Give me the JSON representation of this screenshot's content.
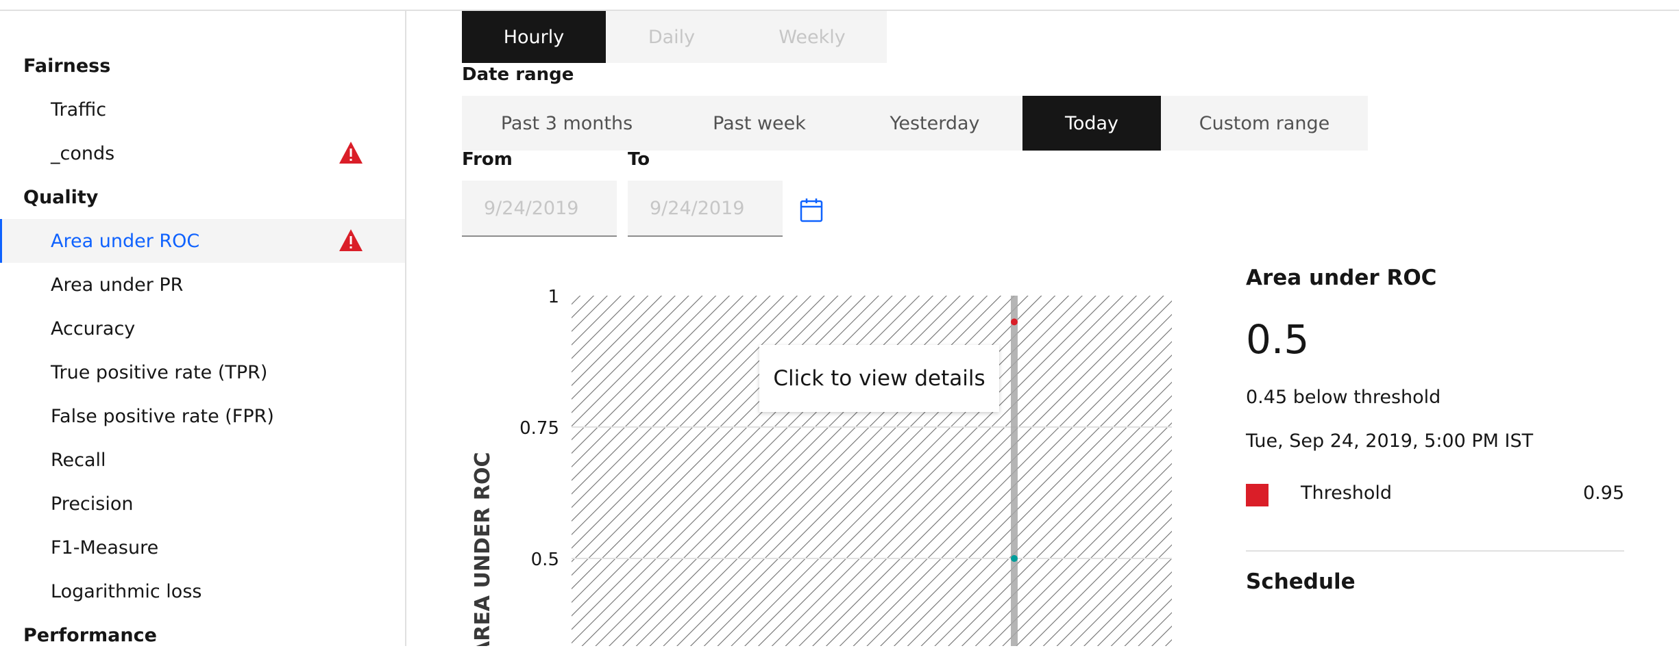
{
  "sidebar": {
    "items": [
      {
        "label": "Fairness",
        "type": "group"
      },
      {
        "label": "Traffic",
        "type": "item"
      },
      {
        "label": "_conds",
        "type": "item",
        "warning": true
      },
      {
        "label": "Quality",
        "type": "group"
      },
      {
        "label": "Area under ROC",
        "type": "item",
        "active": true,
        "warning": true
      },
      {
        "label": "Area under PR",
        "type": "item"
      },
      {
        "label": "Accuracy",
        "type": "item"
      },
      {
        "label": "True positive rate (TPR)",
        "type": "item"
      },
      {
        "label": "False positive rate (FPR)",
        "type": "item"
      },
      {
        "label": "Recall",
        "type": "item"
      },
      {
        "label": "Precision",
        "type": "item"
      },
      {
        "label": "F1-Measure",
        "type": "item"
      },
      {
        "label": "Logarithmic loss",
        "type": "item"
      },
      {
        "label": "Performance",
        "type": "group"
      }
    ]
  },
  "interval": {
    "options": [
      "Hourly",
      "Daily",
      "Weekly"
    ],
    "selected": "Hourly"
  },
  "date_range": {
    "label": "Date range",
    "options": [
      "Past 3 months",
      "Past week",
      "Yesterday",
      "Today",
      "Custom range"
    ],
    "selected": "Today"
  },
  "from": {
    "label": "From",
    "value": "9/24/2019"
  },
  "to": {
    "label": "To",
    "value": "9/24/2019"
  },
  "chart_data": {
    "type": "scatter",
    "ylabel": "AREA UNDER ROC",
    "yticks": [
      "1",
      "0.75",
      "0.5"
    ],
    "ylim": [
      0.25,
      1
    ],
    "series": [
      {
        "values": [
          0.95
        ],
        "color": "#da1e28"
      },
      {
        "values": [
          0.5
        ],
        "color": "#009d9a"
      }
    ],
    "grid": true
  },
  "tooltip": {
    "text": "Click to view details"
  },
  "detail": {
    "title": "Area under ROC",
    "value": "0.5",
    "below": "0.45 below threshold",
    "date": "Tue, Sep 24, 2019, 5:00 PM IST",
    "threshold_label": "Threshold",
    "threshold_value": "0.95",
    "threshold_color": "#da1e28",
    "schedule_title": "Schedule"
  },
  "colors": {
    "accent": "#0f62fe",
    "warning": "#da1e28",
    "selected_bg": "#161616"
  }
}
